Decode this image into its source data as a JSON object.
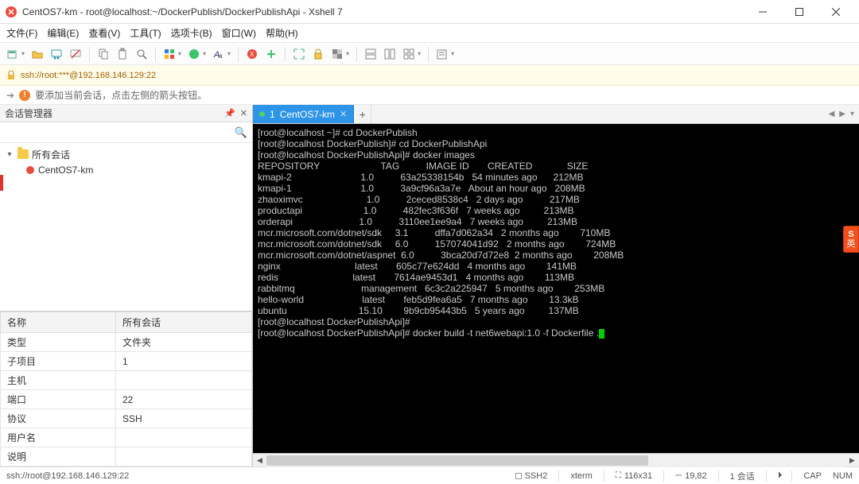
{
  "title": "CentOS7-km - root@localhost:~/DockerPublish/DockerPublishApi - Xshell 7",
  "menubar": [
    "文件(F)",
    "编辑(E)",
    "查看(V)",
    "工具(T)",
    "选项卡(B)",
    "窗口(W)",
    "帮助(H)"
  ],
  "addrbar": {
    "text": "ssh://root:***@192.168.146.129:22"
  },
  "infobar": {
    "text": "要添加当前会话，点击左侧的箭头按钮。"
  },
  "session_mgr": {
    "title": "会话管理器",
    "root": "所有会话",
    "children": [
      "CentOS7-km"
    ]
  },
  "properties": {
    "col1": "名称",
    "col2": "所有会话",
    "rows": [
      {
        "k": "类型",
        "v": "文件夹"
      },
      {
        "k": "子项目",
        "v": "1"
      },
      {
        "k": "主机",
        "v": ""
      },
      {
        "k": "端口",
        "v": "22"
      },
      {
        "k": "协议",
        "v": "SSH"
      },
      {
        "k": "用户名",
        "v": ""
      },
      {
        "k": "说明",
        "v": ""
      }
    ]
  },
  "tabstrip": {
    "active": {
      "index": "1",
      "label": "CentOS7-km"
    },
    "newtab": "+"
  },
  "terminal": {
    "prompt_user": "root@localhost",
    "lines": [
      {
        "prompt": "[root@localhost ~]#",
        "cmd": " cd DockerPublish"
      },
      {
        "prompt": "[root@localhost DockerPublish]#",
        "cmd": " cd DockerPublishApi"
      },
      {
        "prompt": "[root@localhost DockerPublishApi]#",
        "cmd": " docker images"
      }
    ],
    "header": "REPOSITORY                       TAG          IMAGE ID       CREATED             SIZE",
    "rows": [
      "kmapi-2                          1.0          63a25338154b   54 minutes ago      212MB",
      "kmapi-1                          1.0          3a9cf96a3a7e   About an hour ago   208MB",
      "zhaoximvc                        1.0          2ceced8538c4   2 days ago          217MB",
      "productapi                       1.0          482fec3f636f   7 weeks ago         213MB",
      "orderapi                         1.0          3110ee1ee9a4   7 weeks ago         213MB",
      "mcr.microsoft.com/dotnet/sdk     3.1          dffa7d062a34   2 months ago        710MB",
      "mcr.microsoft.com/dotnet/sdk     6.0          157074041d92   2 months ago        724MB",
      "mcr.microsoft.com/dotnet/aspnet  6.0          3bca20d7d72e8  2 months ago        208MB",
      "nginx                            latest       605c77e624dd   4 months ago        141MB",
      "redis                            latest       7614ae9453d1   4 months ago        113MB",
      "rabbitmq                         management   6c3c2a225947   5 months ago        253MB",
      "hello-world                      latest       feb5d9fea6a5   7 months ago        13.3kB",
      "ubuntu                           15.10        9b9cb95443b5   5 years ago         137MB"
    ],
    "trail_prompt": "[root@localhost DockerPublishApi]#",
    "current_cmd": " docker build -t net6webapi:1.0 -f Dockerfile ."
  },
  "statusbar": {
    "left": "ssh://root@192.168.146.129:22",
    "items": [
      "SSH2",
      "xterm",
      "116x31",
      "19,82",
      "1 会话",
      "CAP",
      "NUM"
    ],
    "nav": "⏵"
  },
  "ime": {
    "top": "S",
    "bottom": "英"
  }
}
